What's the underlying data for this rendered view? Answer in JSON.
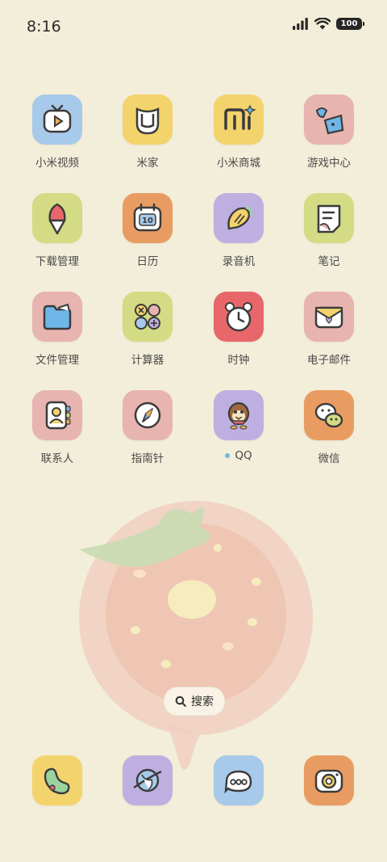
{
  "status": {
    "time": "8:16",
    "battery": "100"
  },
  "apps": [
    {
      "label": "小米视频",
      "icon": "video-icon",
      "color": "#a7c9ea"
    },
    {
      "label": "米家",
      "icon": "mijia-icon",
      "color": "#f3d36c"
    },
    {
      "label": "小米商城",
      "icon": "mi-store-icon",
      "color": "#f3d36c"
    },
    {
      "label": "游戏中心",
      "icon": "game-center-icon",
      "color": "#e8b4af"
    },
    {
      "label": "下载管理",
      "icon": "download-icon",
      "color": "#d3db84"
    },
    {
      "label": "日历",
      "icon": "calendar-icon",
      "color": "#e99c62",
      "day": "10"
    },
    {
      "label": "录音机",
      "icon": "recorder-icon",
      "color": "#bdb0e0"
    },
    {
      "label": "笔记",
      "icon": "notes-icon",
      "color": "#d3db84"
    },
    {
      "label": "文件管理",
      "icon": "folder-icon",
      "color": "#e8b4af"
    },
    {
      "label": "计算器",
      "icon": "calculator-icon",
      "color": "#d3db84"
    },
    {
      "label": "时钟",
      "icon": "clock-icon",
      "color": "#e8676a"
    },
    {
      "label": "电子邮件",
      "icon": "email-icon",
      "color": "#e8b4af"
    },
    {
      "label": "联系人",
      "icon": "contacts-icon",
      "color": "#e8b4af"
    },
    {
      "label": "指南针",
      "icon": "compass-icon",
      "color": "#e8b4af"
    },
    {
      "label": "QQ",
      "icon": "qq-icon",
      "color": "#bdb0e0",
      "dot": true
    },
    {
      "label": "微信",
      "icon": "wechat-icon",
      "color": "#e99c62"
    }
  ],
  "search": {
    "label": "搜索"
  },
  "dock": [
    {
      "icon": "phone-icon",
      "color": "#f3d36c"
    },
    {
      "icon": "browser-icon",
      "color": "#bdb0e0"
    },
    {
      "icon": "messages-icon",
      "color": "#a7c9ea"
    },
    {
      "icon": "camera-icon",
      "color": "#e99c62"
    }
  ]
}
